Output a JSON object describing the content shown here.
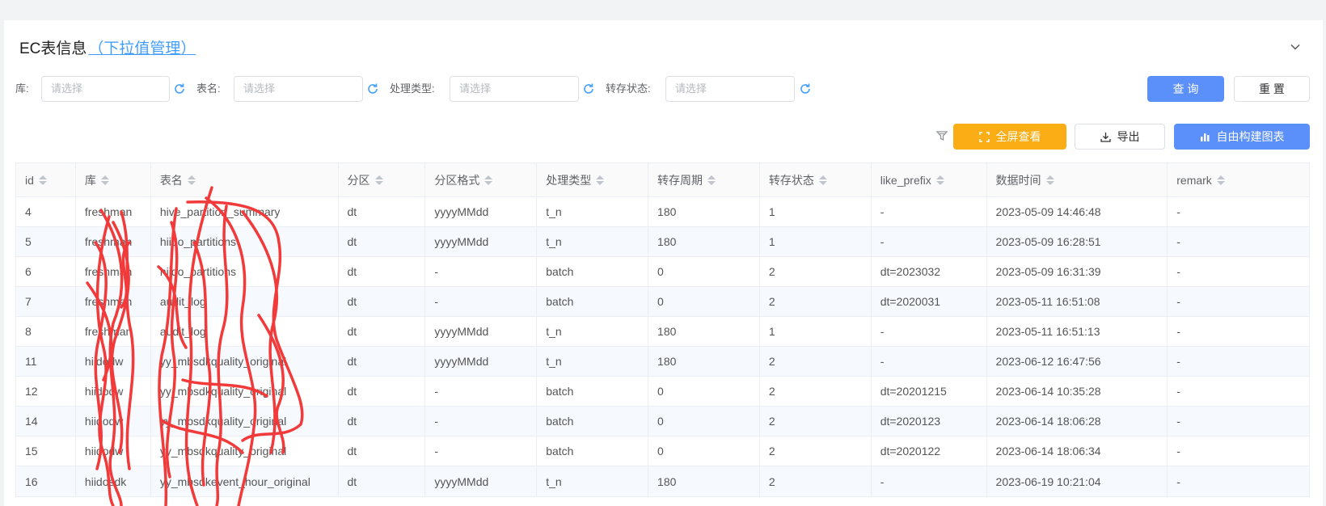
{
  "header": {
    "title": "EC表信息",
    "link_text": "（下拉值管理）"
  },
  "filters": [
    {
      "label": "库:",
      "placeholder": "请选择"
    },
    {
      "label": "表名:",
      "placeholder": "请选择"
    },
    {
      "label": "处理类型:",
      "placeholder": "请选择"
    },
    {
      "label": "转存状态:",
      "placeholder": "请选择"
    }
  ],
  "actions": {
    "query": "查 询",
    "reset": "重 置"
  },
  "toolbar": {
    "fullscreen": "全屏查看",
    "export": "导出",
    "chart": "自由构建图表"
  },
  "icons": [
    "chevron-down-icon",
    "refresh-icon",
    "filter-icon",
    "fullscreen-icon",
    "download-icon",
    "bar-chart-icon",
    "sort-icon"
  ],
  "colors": {
    "primary": "#5b8ff9",
    "warning": "#faad14",
    "link": "#409eff",
    "scribble": "#f23a3a"
  },
  "table": {
    "columns": [
      "id",
      "库",
      "表名",
      "分区",
      "分区格式",
      "处理类型",
      "转存周期",
      "转存状态",
      "like_prefix",
      "数据时间",
      "remark"
    ],
    "rows": [
      [
        "4",
        "freshman",
        "hive_partition_summary",
        "dt",
        "yyyyMMdd",
        "t_n",
        "180",
        "1",
        "-",
        "2023-05-09 14:46:48",
        "-"
      ],
      [
        "5",
        "freshman",
        "hiido_partitions",
        "dt",
        "yyyyMMdd",
        "t_n",
        "180",
        "1",
        "-",
        "2023-05-09 16:28:51",
        "-"
      ],
      [
        "6",
        "freshman",
        "hiido_partitions",
        "dt",
        "-",
        "batch",
        "0",
        "2",
        "dt=2023032",
        "2023-05-09 16:31:39",
        "-"
      ],
      [
        "7",
        "freshman",
        "audit_log",
        "dt",
        "-",
        "batch",
        "0",
        "2",
        "dt=2020031",
        "2023-05-11 16:51:08",
        "-"
      ],
      [
        "8",
        "freshman",
        "audit_log",
        "dt",
        "yyyyMMdd",
        "t_n",
        "180",
        "1",
        "-",
        "2023-05-11 16:51:13",
        "-"
      ],
      [
        "11",
        "hiidodw",
        "yy_mbsdkquality_original",
        "dt",
        "yyyyMMdd",
        "t_n",
        "180",
        "2",
        "-",
        "2023-06-12 16:47:56",
        "-"
      ],
      [
        "12",
        "hiidodw",
        "yy_mbsdkquality_original",
        "dt",
        "-",
        "batch",
        "0",
        "2",
        "dt=20201215",
        "2023-06-14 10:35:28",
        "-"
      ],
      [
        "14",
        "hiidodw",
        "yy_mbsdkquality_original",
        "dt",
        "-",
        "batch",
        "0",
        "2",
        "dt=2020123",
        "2023-06-14 18:06:28",
        "-"
      ],
      [
        "15",
        "hiidodw",
        "yy_mbsdkquality_original",
        "dt",
        "-",
        "batch",
        "0",
        "2",
        "dt=2020122",
        "2023-06-14 18:06:34",
        "-"
      ],
      [
        "16",
        "hiidosdk",
        "yy_mbsdkevent_hour_original",
        "dt",
        "yyyyMMdd",
        "t_n",
        "180",
        "2",
        "-",
        "2023-06-19 10:21:04",
        "-"
      ]
    ]
  }
}
